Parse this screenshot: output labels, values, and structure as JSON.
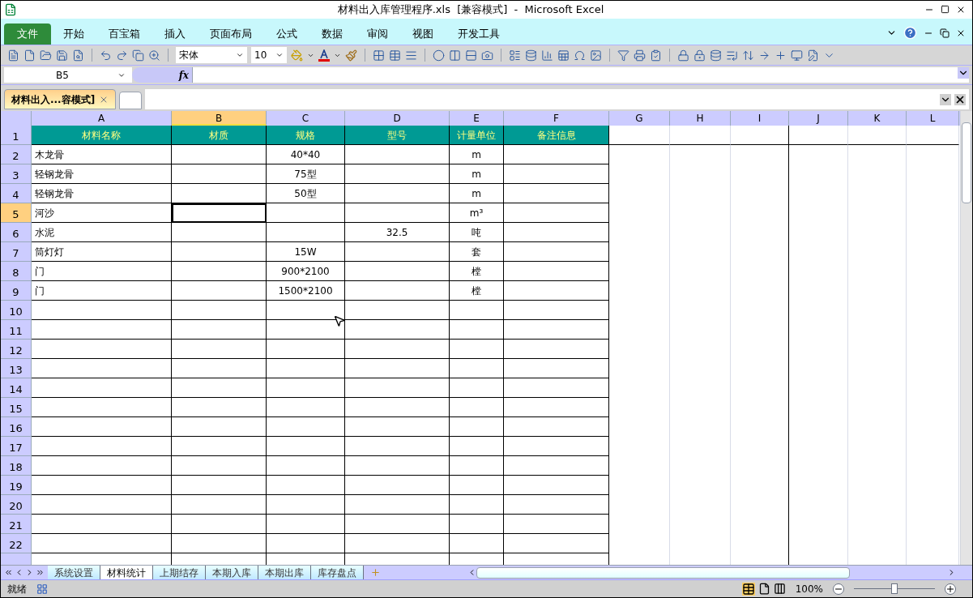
{
  "window": {
    "title": "材料出入库管理程序.xls  [兼容模式]  -  Microsoft Excel"
  },
  "ribbon_tabs": [
    {
      "label": "文件",
      "kind": "file",
      "selected": false
    },
    {
      "label": "开始",
      "kind": "tab",
      "selected": false
    },
    {
      "label": "百宝箱",
      "kind": "tab",
      "selected": false
    },
    {
      "label": "插入",
      "kind": "tab",
      "selected": false
    },
    {
      "label": "页面布局",
      "kind": "tab",
      "selected": false
    },
    {
      "label": "公式",
      "kind": "tab",
      "selected": false
    },
    {
      "label": "数据",
      "kind": "tab",
      "selected": false
    },
    {
      "label": "审阅",
      "kind": "tab",
      "selected": false
    },
    {
      "label": "视图",
      "kind": "tab",
      "selected": false
    },
    {
      "label": "开发工具",
      "kind": "tab",
      "selected": false
    }
  ],
  "toolbar": {
    "font_name": "宋体",
    "font_size": "10"
  },
  "formula_bar": {
    "name_box": "B5",
    "function_symbol": "fx"
  },
  "document_tabs": [
    {
      "label": "材料出入...容模式]",
      "selected": true
    }
  ],
  "columns": [
    {
      "letter": "A",
      "selected": false
    },
    {
      "letter": "B",
      "selected": true
    },
    {
      "letter": "C",
      "selected": false
    },
    {
      "letter": "D",
      "selected": false
    },
    {
      "letter": "E",
      "selected": false
    },
    {
      "letter": "F",
      "selected": false
    },
    {
      "letter": "G",
      "selected": false
    },
    {
      "letter": "H",
      "selected": false
    },
    {
      "letter": "I",
      "selected": false
    },
    {
      "letter": "J",
      "selected": false
    },
    {
      "letter": "K",
      "selected": false
    },
    {
      "letter": "L",
      "selected": false
    }
  ],
  "rows": [
    {
      "number": "1",
      "selected": false,
      "kind": "header",
      "cells": {
        "A": "材料名称",
        "B": "材质",
        "C": "规格",
        "D": "型号",
        "E": "计量单位",
        "F": "备注信息"
      }
    },
    {
      "number": "2",
      "selected": false,
      "kind": "data",
      "cells": {
        "A": "木龙骨",
        "C": "40*40",
        "E": "m"
      }
    },
    {
      "number": "3",
      "selected": false,
      "kind": "data",
      "cells": {
        "A": "轻钢龙骨",
        "C": "75型",
        "E": "m"
      }
    },
    {
      "number": "4",
      "selected": false,
      "kind": "data",
      "cells": {
        "A": "轻钢龙骨",
        "C": "50型",
        "E": "m"
      }
    },
    {
      "number": "5",
      "selected": true,
      "kind": "data",
      "cells": {
        "A": "河沙",
        "E": "m³"
      }
    },
    {
      "number": "6",
      "selected": false,
      "kind": "data",
      "cells": {
        "A": "水泥",
        "D": "32.5",
        "E": "吨"
      }
    },
    {
      "number": "7",
      "selected": false,
      "kind": "data",
      "cells": {
        "A": "筒灯灯",
        "C": "15W",
        "E": "套"
      }
    },
    {
      "number": "8",
      "selected": false,
      "kind": "data",
      "cells": {
        "A": "门",
        "C": "900*2100",
        "E": "樘"
      }
    },
    {
      "number": "9",
      "selected": false,
      "kind": "data",
      "cells": {
        "A": "门",
        "C": "1500*2100",
        "E": "樘"
      }
    },
    {
      "number": "10",
      "selected": false,
      "kind": "data",
      "cells": {}
    },
    {
      "number": "11",
      "selected": false,
      "kind": "data",
      "cells": {}
    },
    {
      "number": "12",
      "selected": false,
      "kind": "data",
      "cells": {}
    },
    {
      "number": "13",
      "selected": false,
      "kind": "data",
      "cells": {}
    },
    {
      "number": "14",
      "selected": false,
      "kind": "data",
      "cells": {}
    },
    {
      "number": "15",
      "selected": false,
      "kind": "data",
      "cells": {}
    },
    {
      "number": "16",
      "selected": false,
      "kind": "data",
      "cells": {}
    },
    {
      "number": "17",
      "selected": false,
      "kind": "data",
      "cells": {}
    },
    {
      "number": "18",
      "selected": false,
      "kind": "data",
      "cells": {}
    },
    {
      "number": "19",
      "selected": false,
      "kind": "data",
      "cells": {}
    },
    {
      "number": "20",
      "selected": false,
      "kind": "data",
      "cells": {}
    },
    {
      "number": "21",
      "selected": false,
      "kind": "data",
      "cells": {}
    },
    {
      "number": "22",
      "selected": false,
      "kind": "data",
      "cells": {}
    }
  ],
  "sheet_tabs": [
    {
      "label": "系统设置",
      "selected": false
    },
    {
      "label": "材料统计",
      "selected": true
    },
    {
      "label": "上期结存",
      "selected": false
    },
    {
      "label": "本期入库",
      "selected": false
    },
    {
      "label": "本期出库",
      "selected": false
    },
    {
      "label": "库存盘点",
      "selected": false
    }
  ],
  "status_bar": {
    "status": "就绪",
    "zoom": "100%",
    "zoom_slider": {
      "level": 0.5
    }
  }
}
